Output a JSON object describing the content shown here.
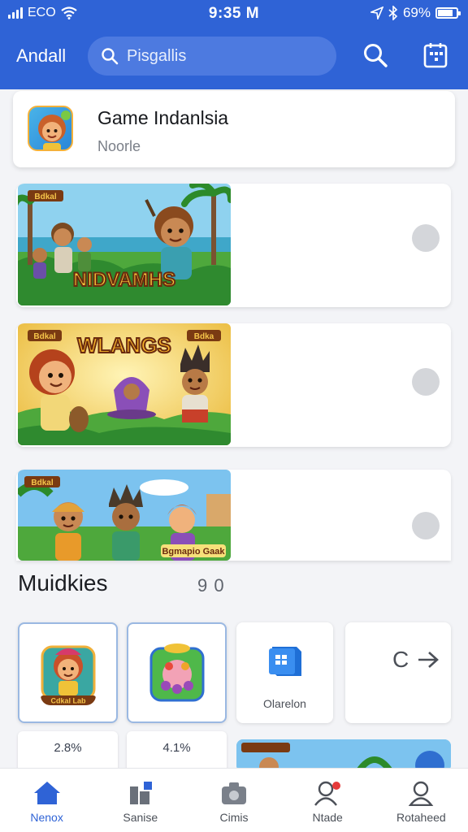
{
  "status": {
    "carrier": "ECO",
    "time": "9:35 M",
    "battery": "69%"
  },
  "header": {
    "app_title": "Andall",
    "search_placeholder": "Pisgallis"
  },
  "featured": {
    "title": "Game Indanlsia",
    "subtitle": "Noorle",
    "icon": "cartoon-girl-icon"
  },
  "games": [
    {
      "banner_title": "NIDVAMHS",
      "badge": "Bdkal",
      "art": "village-heroes-banner",
      "colors": [
        "#56b848",
        "#e9d26a"
      ]
    },
    {
      "banner_title": "WLANGS",
      "badge": "Bdkal",
      "badge_right": "Bdka",
      "art": "jungle-friends-banner",
      "colors": [
        "#f0c63a",
        "#5fae3a"
      ]
    },
    {
      "banner_title": "Bgmapio Gaak",
      "badge": "Bdkal",
      "art": "kids-adventure-banner",
      "colors": [
        "#6fb6ea",
        "#59a842"
      ]
    }
  ],
  "section": {
    "title": "Muidkies",
    "count": "9 0"
  },
  "mini_cards": [
    {
      "label": "Cdkal Lab",
      "selected": true,
      "icon": "girl-character-icon"
    },
    {
      "label": "",
      "selected": true,
      "icon": "fruit-basket-icon"
    },
    {
      "label": "Olarelon",
      "selected": false,
      "icon": "app-cube-icon"
    },
    {
      "label": "C",
      "selected": false,
      "icon": "forward-arrow-icon"
    }
  ],
  "pct_cards": [
    {
      "value": "2.8%"
    },
    {
      "value": "4.1%"
    }
  ],
  "nav": [
    {
      "label": "Nenox",
      "icon": "home-icon",
      "active": true
    },
    {
      "label": "Sanise",
      "icon": "chart-icon",
      "active": false
    },
    {
      "label": "Cimis",
      "icon": "camera-icon",
      "active": false
    },
    {
      "label": "Ntade",
      "icon": "profile-alert-icon",
      "active": false
    },
    {
      "label": "Rotaheed",
      "icon": "person-icon",
      "active": false
    }
  ],
  "colors": {
    "primary": "#2f63d6",
    "search_bg": "#4d7ae0",
    "dot": "#d4d6da"
  }
}
